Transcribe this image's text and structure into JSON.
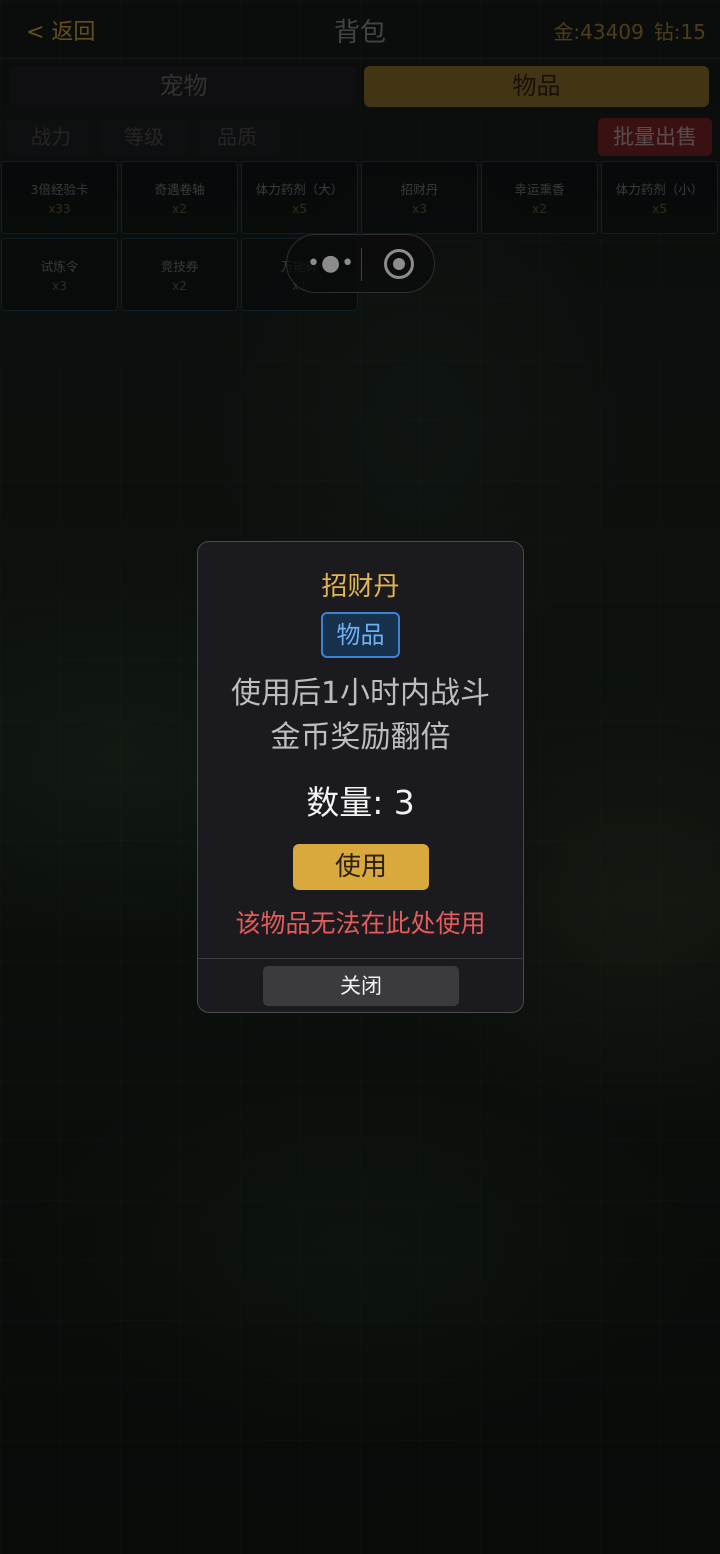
{
  "header": {
    "back_label": "< 返回",
    "title": "背包",
    "gold": "金:43409",
    "diamond": "钻:15"
  },
  "tabs": [
    {
      "label": "宠物",
      "active": false
    },
    {
      "label": "物品",
      "active": true
    }
  ],
  "filters": [
    "战力",
    "等级",
    "品质"
  ],
  "bulk_sell_label": "批量出售",
  "items": [
    {
      "name": "3倍经验卡",
      "count": "x33"
    },
    {
      "name": "奇遇卷轴",
      "count": "x2"
    },
    {
      "name": "体力药剂（大）",
      "count": "x5"
    },
    {
      "name": "招财丹",
      "count": "x3"
    },
    {
      "name": "幸运熏香",
      "count": "x2"
    },
    {
      "name": "体力药剂（小）",
      "count": "x5"
    },
    {
      "name": "试炼令",
      "count": "x3"
    },
    {
      "name": "竞技券",
      "count": "x2"
    },
    {
      "name": "万能碎",
      "count": "x1"
    }
  ],
  "capsule": {
    "more_icon": "more-dots-icon",
    "close_icon": "target-circle-icon"
  },
  "modal": {
    "title": "招财丹",
    "badge": "物品",
    "description_line1": "使用后1小时内战斗",
    "description_line2": "金币奖励翻倍",
    "quantity": "数量: 3",
    "use_label": "使用",
    "warning": "该物品无法在此处使用",
    "close_label": "关闭"
  },
  "colors": {
    "accent_gold": "#d9a93e",
    "title_gold": "#e2b54e",
    "warning_red": "#e55a5a",
    "badge_blue": "#3b82d4",
    "bulk_red": "#6b1f21"
  }
}
